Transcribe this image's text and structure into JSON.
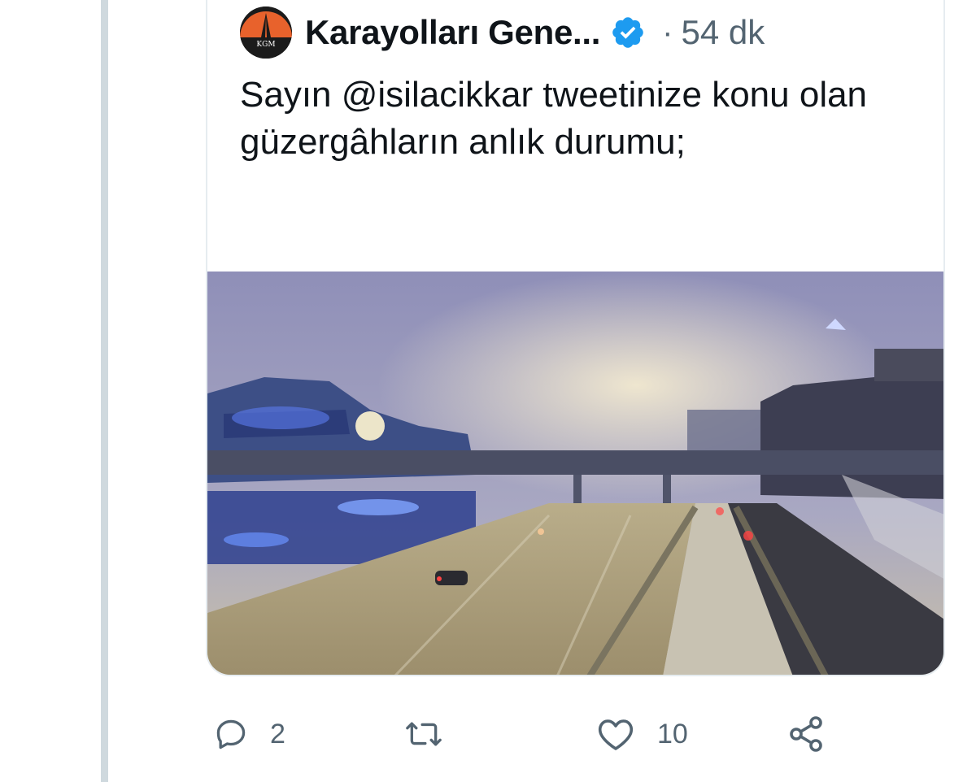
{
  "tweet": {
    "author_name": "Karayolları Gene...",
    "separator": "·",
    "time": "54 dk",
    "avatar_text": "KGM",
    "text": "Sayın @isilacikkar tweetinize konu olan güzergâhların anlık durumu;"
  },
  "actions": {
    "reply_count": "2",
    "like_count": "10"
  },
  "colors": {
    "verified": "#1d9bf0",
    "muted": "#536471",
    "avatar_accent": "#e8622c"
  },
  "icons": [
    "reply-icon",
    "retweet-icon",
    "like-icon",
    "share-icon",
    "verified-badge-icon"
  ]
}
